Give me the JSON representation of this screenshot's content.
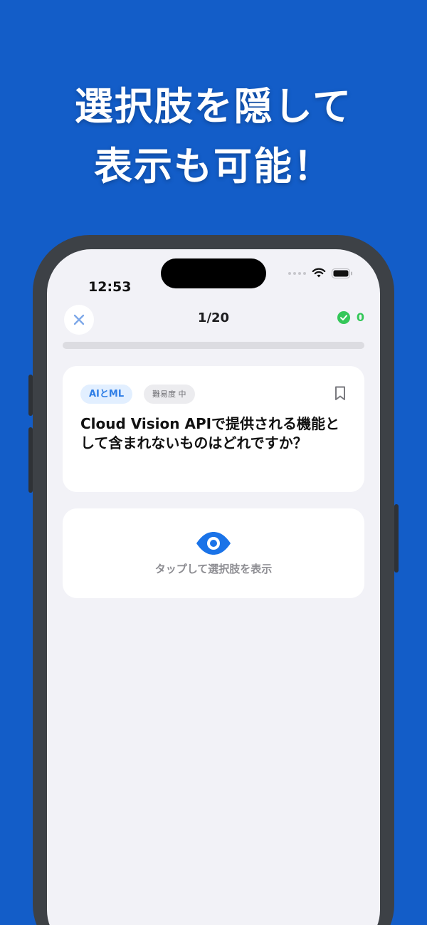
{
  "promo": {
    "headline_line1": "選択肢を隠して",
    "headline_line2": "表示も可能！"
  },
  "status_bar": {
    "time": "12:53"
  },
  "quiz_header": {
    "progress_text": "1/20",
    "correct_count": "0",
    "progress_fraction": 0.0
  },
  "question_card": {
    "category_tag": "AIとML",
    "difficulty_tag": "難易度 中",
    "question_text": "Cloud Vision APIで提供される機能として含まれないものはどれですか？"
  },
  "reveal": {
    "label": "タップして選択肢を表示"
  },
  "colors": {
    "background": "#135dc8",
    "accent": "#1a73e8",
    "success": "#34c759"
  },
  "icons": [
    "close-icon",
    "check-circle-icon",
    "bookmark-icon",
    "eye-icon",
    "wifi-icon",
    "battery-icon"
  ]
}
